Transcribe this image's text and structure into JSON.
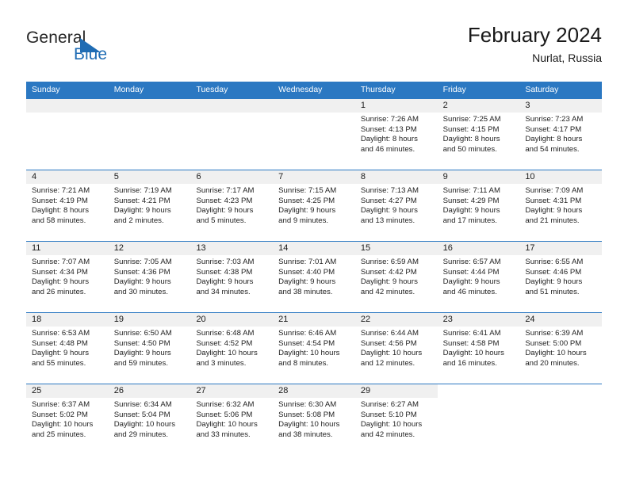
{
  "brand": {
    "name_part1": "General",
    "name_part2": "Blue",
    "flag_icon": "triangle-flag-icon",
    "accent_color": "#1f6cb4"
  },
  "header": {
    "title": "February 2024",
    "location": "Nurlat, Russia"
  },
  "theme": {
    "header_bg": "#2b78c2",
    "header_text": "#ffffff",
    "date_band_bg": "#f0f0f0",
    "cell_bg": "#ffffff",
    "body_text": "#232323"
  },
  "weekday_headers": [
    "Sunday",
    "Monday",
    "Tuesday",
    "Wednesday",
    "Thursday",
    "Friday",
    "Saturday"
  ],
  "weeks": [
    [
      {
        "date": "",
        "blank": true
      },
      {
        "date": "",
        "blank": true
      },
      {
        "date": "",
        "blank": true
      },
      {
        "date": "",
        "blank": true
      },
      {
        "date": "1",
        "sunrise": "Sunrise: 7:26 AM",
        "sunset": "Sunset: 4:13 PM",
        "daylight_line1": "Daylight: 8 hours",
        "daylight_line2": "and 46 minutes."
      },
      {
        "date": "2",
        "sunrise": "Sunrise: 7:25 AM",
        "sunset": "Sunset: 4:15 PM",
        "daylight_line1": "Daylight: 8 hours",
        "daylight_line2": "and 50 minutes."
      },
      {
        "date": "3",
        "sunrise": "Sunrise: 7:23 AM",
        "sunset": "Sunset: 4:17 PM",
        "daylight_line1": "Daylight: 8 hours",
        "daylight_line2": "and 54 minutes."
      }
    ],
    [
      {
        "date": "4",
        "sunrise": "Sunrise: 7:21 AM",
        "sunset": "Sunset: 4:19 PM",
        "daylight_line1": "Daylight: 8 hours",
        "daylight_line2": "and 58 minutes."
      },
      {
        "date": "5",
        "sunrise": "Sunrise: 7:19 AM",
        "sunset": "Sunset: 4:21 PM",
        "daylight_line1": "Daylight: 9 hours",
        "daylight_line2": "and 2 minutes."
      },
      {
        "date": "6",
        "sunrise": "Sunrise: 7:17 AM",
        "sunset": "Sunset: 4:23 PM",
        "daylight_line1": "Daylight: 9 hours",
        "daylight_line2": "and 5 minutes."
      },
      {
        "date": "7",
        "sunrise": "Sunrise: 7:15 AM",
        "sunset": "Sunset: 4:25 PM",
        "daylight_line1": "Daylight: 9 hours",
        "daylight_line2": "and 9 minutes."
      },
      {
        "date": "8",
        "sunrise": "Sunrise: 7:13 AM",
        "sunset": "Sunset: 4:27 PM",
        "daylight_line1": "Daylight: 9 hours",
        "daylight_line2": "and 13 minutes."
      },
      {
        "date": "9",
        "sunrise": "Sunrise: 7:11 AM",
        "sunset": "Sunset: 4:29 PM",
        "daylight_line1": "Daylight: 9 hours",
        "daylight_line2": "and 17 minutes."
      },
      {
        "date": "10",
        "sunrise": "Sunrise: 7:09 AM",
        "sunset": "Sunset: 4:31 PM",
        "daylight_line1": "Daylight: 9 hours",
        "daylight_line2": "and 21 minutes."
      }
    ],
    [
      {
        "date": "11",
        "sunrise": "Sunrise: 7:07 AM",
        "sunset": "Sunset: 4:34 PM",
        "daylight_line1": "Daylight: 9 hours",
        "daylight_line2": "and 26 minutes."
      },
      {
        "date": "12",
        "sunrise": "Sunrise: 7:05 AM",
        "sunset": "Sunset: 4:36 PM",
        "daylight_line1": "Daylight: 9 hours",
        "daylight_line2": "and 30 minutes."
      },
      {
        "date": "13",
        "sunrise": "Sunrise: 7:03 AM",
        "sunset": "Sunset: 4:38 PM",
        "daylight_line1": "Daylight: 9 hours",
        "daylight_line2": "and 34 minutes."
      },
      {
        "date": "14",
        "sunrise": "Sunrise: 7:01 AM",
        "sunset": "Sunset: 4:40 PM",
        "daylight_line1": "Daylight: 9 hours",
        "daylight_line2": "and 38 minutes."
      },
      {
        "date": "15",
        "sunrise": "Sunrise: 6:59 AM",
        "sunset": "Sunset: 4:42 PM",
        "daylight_line1": "Daylight: 9 hours",
        "daylight_line2": "and 42 minutes."
      },
      {
        "date": "16",
        "sunrise": "Sunrise: 6:57 AM",
        "sunset": "Sunset: 4:44 PM",
        "daylight_line1": "Daylight: 9 hours",
        "daylight_line2": "and 46 minutes."
      },
      {
        "date": "17",
        "sunrise": "Sunrise: 6:55 AM",
        "sunset": "Sunset: 4:46 PM",
        "daylight_line1": "Daylight: 9 hours",
        "daylight_line2": "and 51 minutes."
      }
    ],
    [
      {
        "date": "18",
        "sunrise": "Sunrise: 6:53 AM",
        "sunset": "Sunset: 4:48 PM",
        "daylight_line1": "Daylight: 9 hours",
        "daylight_line2": "and 55 minutes."
      },
      {
        "date": "19",
        "sunrise": "Sunrise: 6:50 AM",
        "sunset": "Sunset: 4:50 PM",
        "daylight_line1": "Daylight: 9 hours",
        "daylight_line2": "and 59 minutes."
      },
      {
        "date": "20",
        "sunrise": "Sunrise: 6:48 AM",
        "sunset": "Sunset: 4:52 PM",
        "daylight_line1": "Daylight: 10 hours",
        "daylight_line2": "and 3 minutes."
      },
      {
        "date": "21",
        "sunrise": "Sunrise: 6:46 AM",
        "sunset": "Sunset: 4:54 PM",
        "daylight_line1": "Daylight: 10 hours",
        "daylight_line2": "and 8 minutes."
      },
      {
        "date": "22",
        "sunrise": "Sunrise: 6:44 AM",
        "sunset": "Sunset: 4:56 PM",
        "daylight_line1": "Daylight: 10 hours",
        "daylight_line2": "and 12 minutes."
      },
      {
        "date": "23",
        "sunrise": "Sunrise: 6:41 AM",
        "sunset": "Sunset: 4:58 PM",
        "daylight_line1": "Daylight: 10 hours",
        "daylight_line2": "and 16 minutes."
      },
      {
        "date": "24",
        "sunrise": "Sunrise: 6:39 AM",
        "sunset": "Sunset: 5:00 PM",
        "daylight_line1": "Daylight: 10 hours",
        "daylight_line2": "and 20 minutes."
      }
    ],
    [
      {
        "date": "25",
        "sunrise": "Sunrise: 6:37 AM",
        "sunset": "Sunset: 5:02 PM",
        "daylight_line1": "Daylight: 10 hours",
        "daylight_line2": "and 25 minutes."
      },
      {
        "date": "26",
        "sunrise": "Sunrise: 6:34 AM",
        "sunset": "Sunset: 5:04 PM",
        "daylight_line1": "Daylight: 10 hours",
        "daylight_line2": "and 29 minutes."
      },
      {
        "date": "27",
        "sunrise": "Sunrise: 6:32 AM",
        "sunset": "Sunset: 5:06 PM",
        "daylight_line1": "Daylight: 10 hours",
        "daylight_line2": "and 33 minutes."
      },
      {
        "date": "28",
        "sunrise": "Sunrise: 6:30 AM",
        "sunset": "Sunset: 5:08 PM",
        "daylight_line1": "Daylight: 10 hours",
        "daylight_line2": "and 38 minutes."
      },
      {
        "date": "29",
        "sunrise": "Sunrise: 6:27 AM",
        "sunset": "Sunset: 5:10 PM",
        "daylight_line1": "Daylight: 10 hours",
        "daylight_line2": "and 42 minutes."
      },
      {
        "date": "",
        "blank": true
      },
      {
        "date": "",
        "blank": true
      }
    ]
  ]
}
